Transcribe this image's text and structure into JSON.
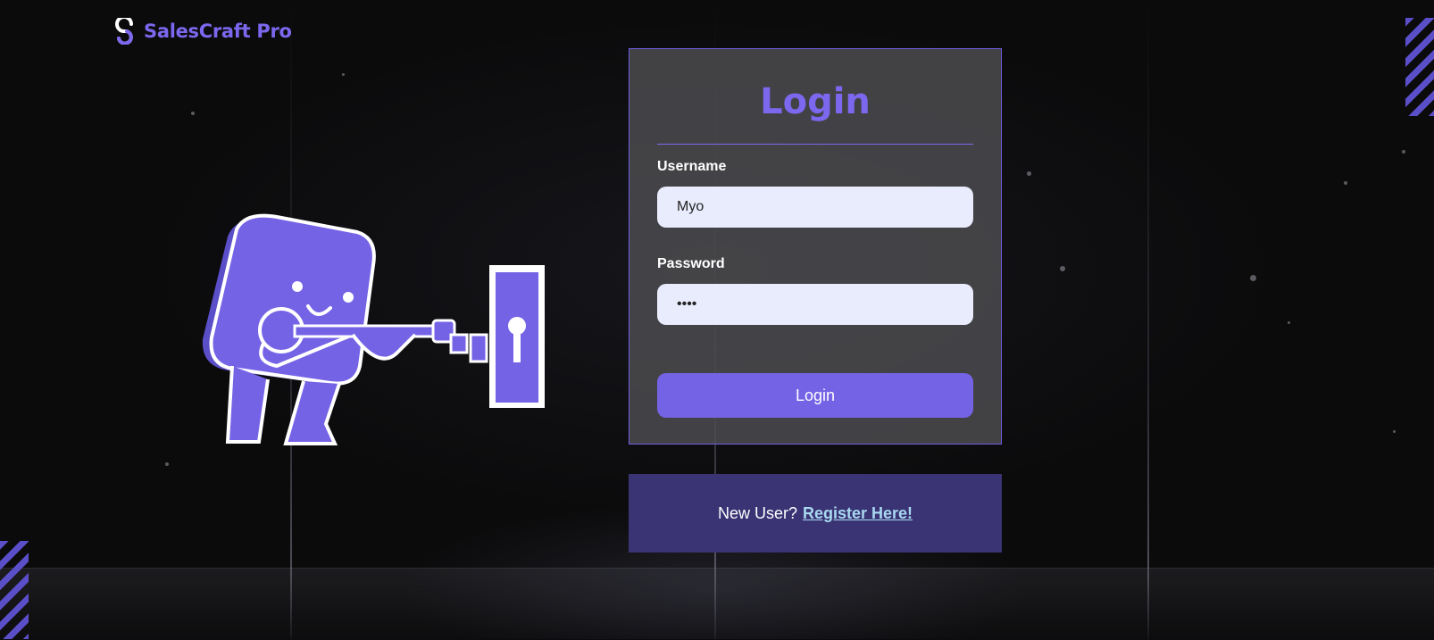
{
  "brand": {
    "name": "SalesCraft Pro",
    "color": "#7b68ee",
    "icon": "salescraft-logo-icon"
  },
  "login": {
    "title": "Login",
    "username": {
      "label": "Username",
      "value": "Myo"
    },
    "password": {
      "label": "Password",
      "value": "1234"
    },
    "submit_label": "Login"
  },
  "register": {
    "prompt": "New User?",
    "link_label": "Register Here!"
  },
  "illustration": {
    "icon": "character-unlocking-door-illustration"
  },
  "colors": {
    "accent": "#7563e6",
    "input_bg": "#e9ecfd",
    "register_bg": "#3a3374",
    "link": "#a8d8f0"
  }
}
